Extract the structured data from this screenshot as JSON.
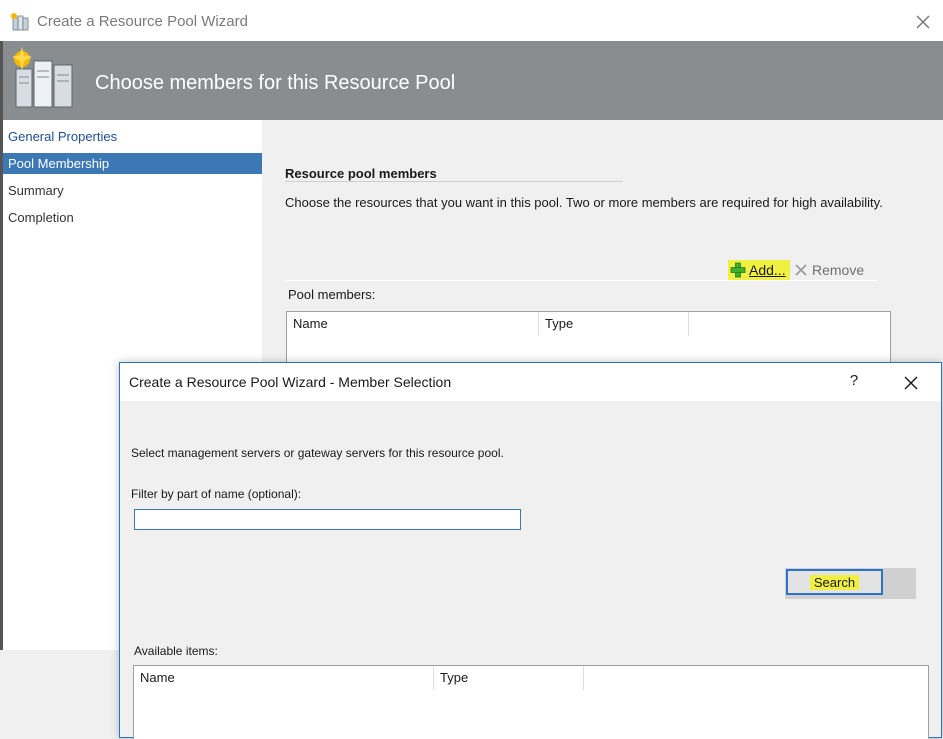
{
  "outer_window": {
    "title": "Create a Resource Pool Wizard",
    "banner_title": "Choose members for this Resource Pool"
  },
  "nav": {
    "items": [
      {
        "label": "General Properties",
        "state": "link"
      },
      {
        "label": "Pool Membership",
        "state": "active"
      },
      {
        "label": "Summary",
        "state": "normal"
      },
      {
        "label": "Completion",
        "state": "normal"
      }
    ]
  },
  "content": {
    "section_title": "Resource pool members",
    "description": "Choose the resources that you want in this pool. Two or more members are required for high availability.",
    "add_label": "Add...",
    "remove_label": "Remove",
    "pool_members_label": "Pool members:",
    "columns": [
      "Name",
      "Type"
    ]
  },
  "dialog": {
    "title": "Create a Resource Pool Wizard - Member Selection",
    "help_label": "?",
    "instruction": "Select management servers or gateway servers for this resource pool.",
    "filter_label": "Filter by part of name (optional):",
    "filter_value": "",
    "search_label": "Search",
    "available_label": "Available items:",
    "columns": [
      "Name",
      "Type"
    ]
  },
  "colors": {
    "highlight": "#f0f042",
    "accent": "#3c78b4",
    "banner": "#8a8d90"
  }
}
